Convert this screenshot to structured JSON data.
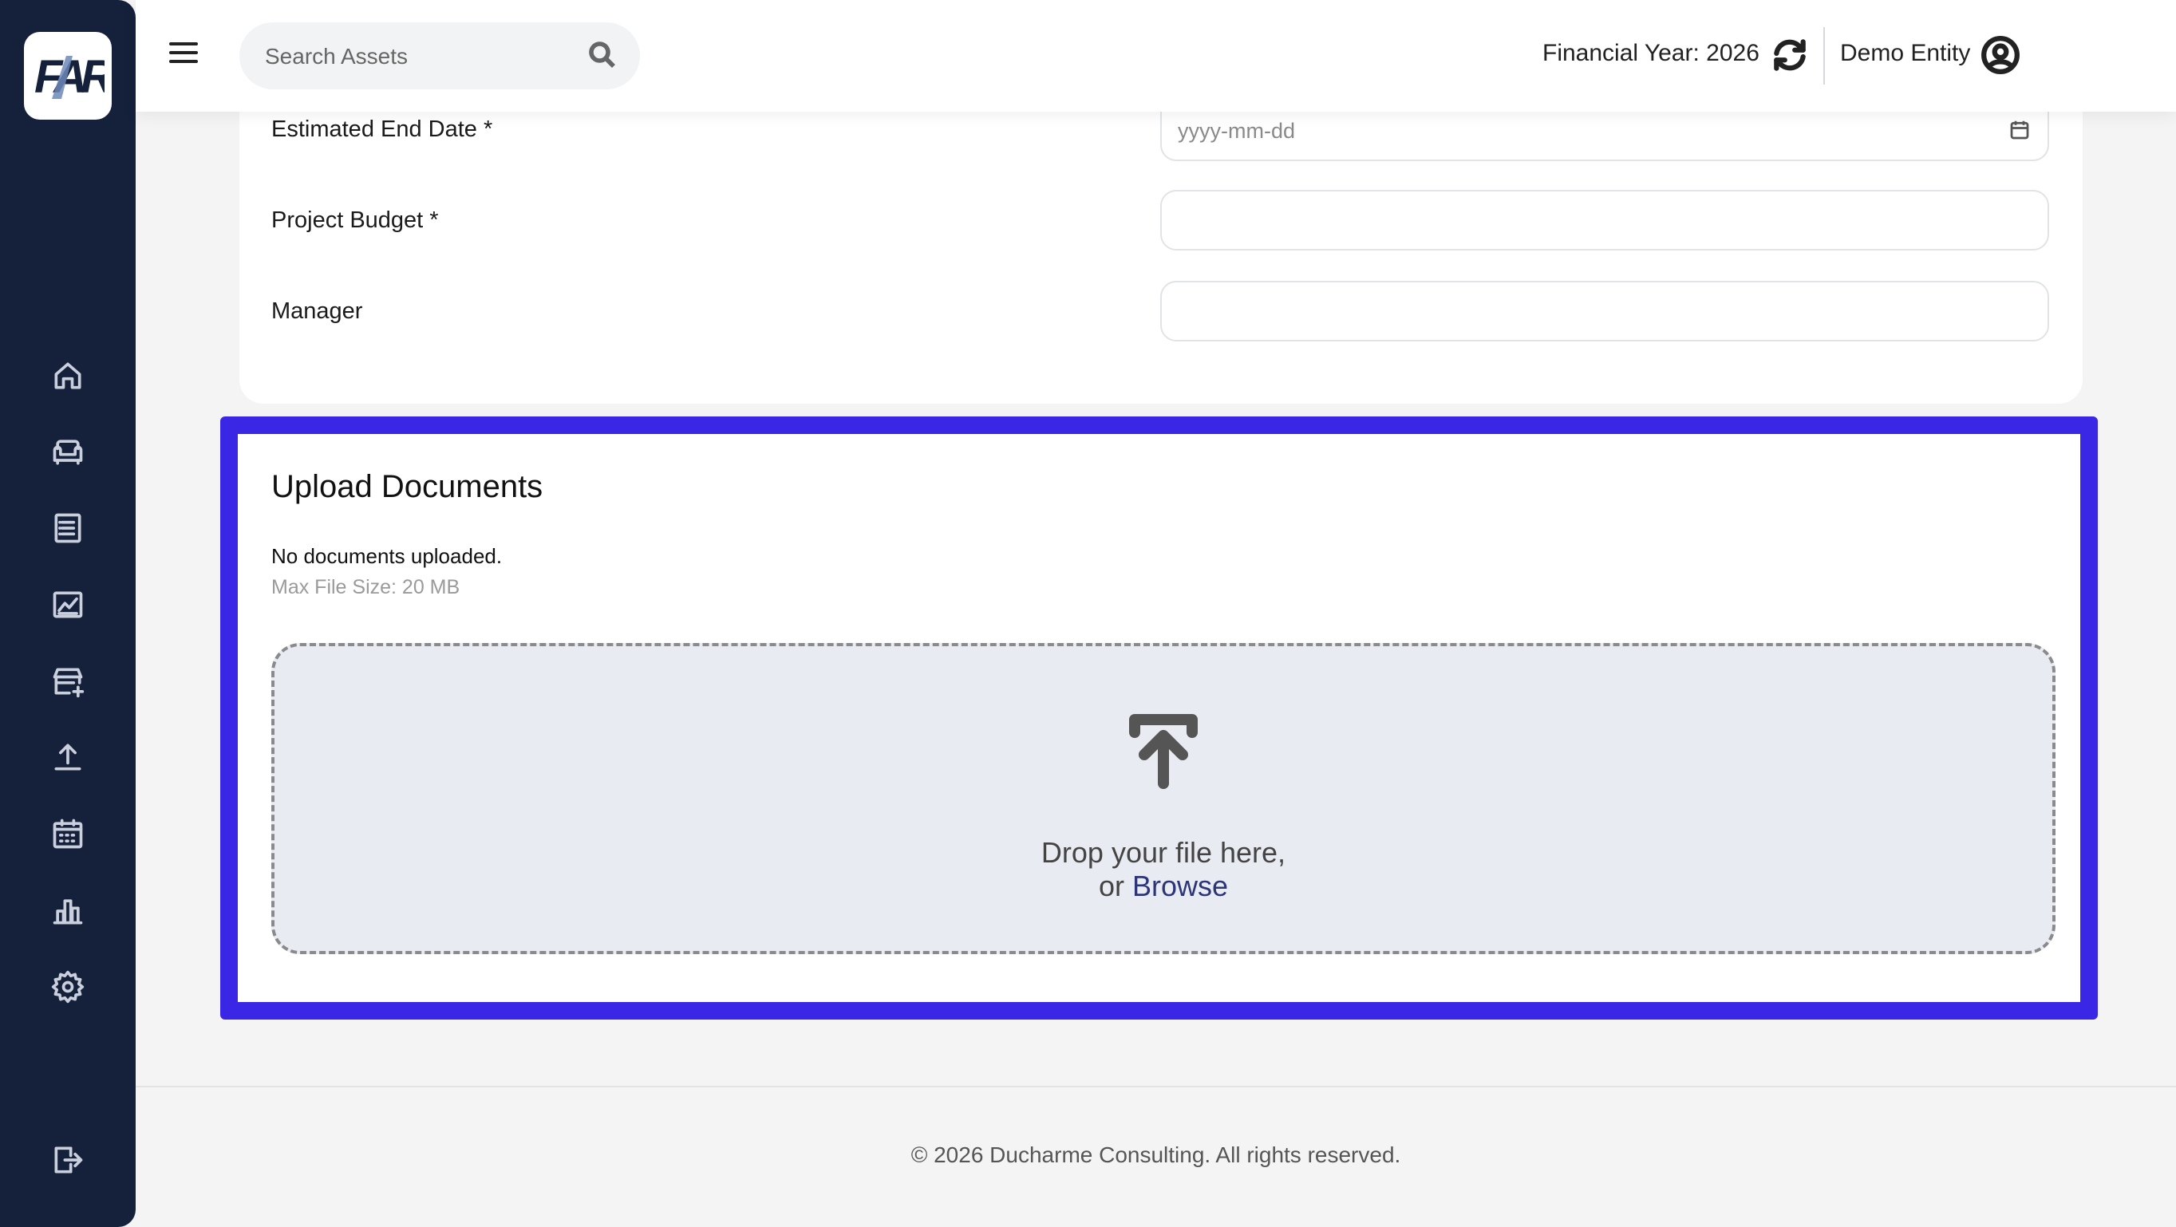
{
  "app": {
    "logo_text": "FAR"
  },
  "sidebar": {
    "items": [
      {
        "icon": "home-icon",
        "label": "Home"
      },
      {
        "icon": "sofa-icon",
        "label": "Assets"
      },
      {
        "icon": "list-icon",
        "label": "Registers"
      },
      {
        "icon": "chart-icon",
        "label": "Analytics"
      },
      {
        "icon": "store-add-icon",
        "label": "Add Store"
      },
      {
        "icon": "upload-icon",
        "label": "Upload"
      },
      {
        "icon": "calendar-icon",
        "label": "Calendar"
      },
      {
        "icon": "bar-chart-icon",
        "label": "Reports"
      },
      {
        "icon": "gear-icon",
        "label": "Settings"
      }
    ],
    "logout_icon": "logout-icon"
  },
  "header": {
    "search_placeholder": "Search Assets",
    "financial_year_label": "Financial Year: 2026",
    "entity": "Demo Entity"
  },
  "form": {
    "end_date_label": "Estimated End Date *",
    "end_date_placeholder": "yyyy-mm-dd",
    "budget_label": "Project Budget *",
    "budget_value": "",
    "manager_label": "Manager",
    "manager_value": ""
  },
  "upload": {
    "title": "Upload Documents",
    "status": "No documents uploaded.",
    "max_size": "Max File Size: 20 MB",
    "drop_line1": "Drop your file here,",
    "drop_or": "or ",
    "browse": "Browse"
  },
  "footer": {
    "text": "© 2026 Ducharme Consulting. All rights reserved."
  },
  "colors": {
    "sidebar_bg": "#15203a",
    "highlight": "#3a27e6",
    "dropzone_bg": "#e9ebf2",
    "browse_link": "#2c3578"
  }
}
